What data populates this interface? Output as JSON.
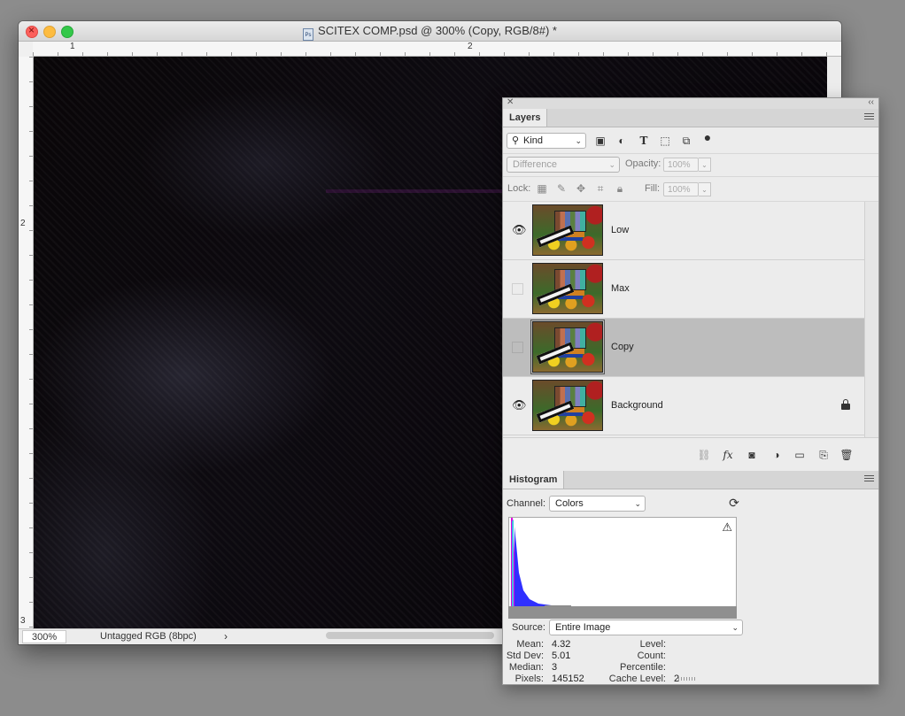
{
  "document": {
    "title": "SCITEX COMP.psd @ 300% (Copy, RGB/8#) *",
    "ruler_top_labels": [
      "1",
      "2"
    ],
    "ruler_left_labels": [
      "2",
      "3"
    ],
    "zoom": "300%",
    "doc_info": "Untagged RGB (8bpc)",
    "status_arrow": "›"
  },
  "layers_panel": {
    "tab_label": "Layers",
    "filter": {
      "value": "Kind"
    },
    "blend_mode": {
      "value": "Difference"
    },
    "opacity": {
      "label": "Opacity:",
      "value": "100%"
    },
    "lock": {
      "label": "Lock:"
    },
    "fill": {
      "label": "Fill:",
      "value": "100%"
    },
    "layers": [
      {
        "name": "Low",
        "visible": true,
        "selected": false,
        "locked": false
      },
      {
        "name": "Max",
        "visible": false,
        "selected": false,
        "locked": false
      },
      {
        "name": "Copy",
        "visible": false,
        "selected": true,
        "locked": false
      },
      {
        "name": "Background",
        "visible": true,
        "selected": false,
        "locked": true
      }
    ]
  },
  "histogram_panel": {
    "tab_label": "Histogram",
    "channel": {
      "label": "Channel:",
      "value": "Colors"
    },
    "source": {
      "label": "Source:",
      "value": "Entire Image"
    },
    "stats_left": [
      {
        "label": "Mean:",
        "value": "4.32"
      },
      {
        "label": "Std Dev:",
        "value": "5.01"
      },
      {
        "label": "Median:",
        "value": "3"
      },
      {
        "label": "Pixels:",
        "value": "145152"
      }
    ],
    "stats_right": [
      {
        "label": "Level:",
        "value": ""
      },
      {
        "label": "Count:",
        "value": ""
      },
      {
        "label": "Percentile:",
        "value": ""
      },
      {
        "label": "Cache Level:",
        "value": "2"
      }
    ],
    "colors": {
      "magenta": "#e000e0",
      "blue": "#3030ff",
      "cyan": "#40c0e0"
    }
  },
  "icons": {
    "eye": "👁",
    "lock": "lock-icon",
    "warning": "⚠",
    "refresh": "⟳"
  }
}
